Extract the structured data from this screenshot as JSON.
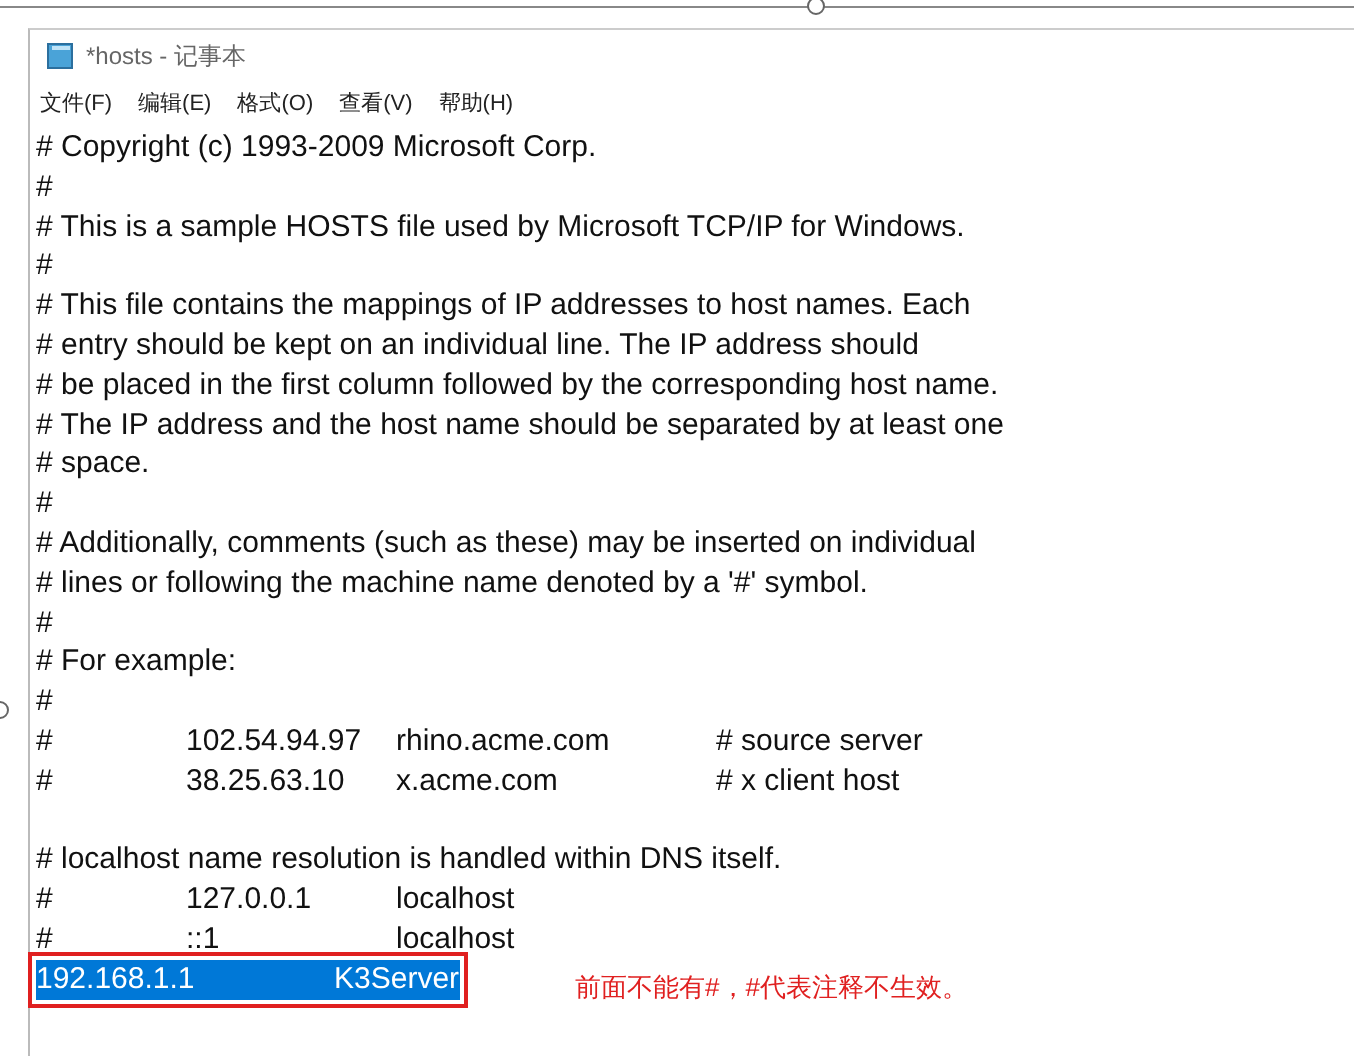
{
  "window": {
    "title": "*hosts - 记事本"
  },
  "menu": [
    {
      "label": "文件(F)"
    },
    {
      "label": "编辑(E)"
    },
    {
      "label": "格式(O)"
    },
    {
      "label": "查看(V)"
    },
    {
      "label": "帮助(H)"
    }
  ],
  "lines": [
    {
      "kind": "text",
      "text": "# Copyright (c) 1993-2009 Microsoft Corp."
    },
    {
      "kind": "text",
      "text": "#"
    },
    {
      "kind": "text",
      "text": "# This is a sample HOSTS file used by Microsoft TCP/IP for Windows."
    },
    {
      "kind": "text",
      "text": "#"
    },
    {
      "kind": "text",
      "text": "# This file contains the mappings of IP addresses to host names. Each"
    },
    {
      "kind": "text",
      "text": "# entry should be kept on an individual line. The IP address should"
    },
    {
      "kind": "text",
      "text": "# be placed in the first column followed by the corresponding host name."
    },
    {
      "kind": "text",
      "text": "# The IP address and the host name should be separated by at least one"
    },
    {
      "kind": "text",
      "text": "# space."
    },
    {
      "kind": "text",
      "text": "#"
    },
    {
      "kind": "text",
      "text": "# Additionally, comments (such as these) may be inserted on individual"
    },
    {
      "kind": "text",
      "text": "# lines or following the machine name denoted by a '#' symbol."
    },
    {
      "kind": "text",
      "text": "#"
    },
    {
      "kind": "text",
      "text": "# For example:"
    },
    {
      "kind": "text",
      "text": "#"
    },
    {
      "kind": "columns",
      "selected": false,
      "cells": [
        "#",
        "102.54.94.97",
        "rhino.acme.com",
        "# source server"
      ]
    },
    {
      "kind": "columns",
      "selected": false,
      "cells": [
        "#",
        "38.25.63.10",
        "x.acme.com",
        "# x client host"
      ]
    },
    {
      "kind": "blank"
    },
    {
      "kind": "text",
      "text": "# localhost name resolution is handled within DNS itself."
    },
    {
      "kind": "columns",
      "selected": false,
      "cells": [
        "#",
        "127.0.0.1",
        "localhost"
      ]
    },
    {
      "kind": "columns",
      "selected": false,
      "cells": [
        "#",
        "::1",
        "localhost"
      ]
    },
    {
      "kind": "columns",
      "selected": true,
      "cells": [
        "192.168.1.1",
        "K3Server"
      ],
      "annotation": "前面不能有#，#代表注释不生效。"
    }
  ]
}
